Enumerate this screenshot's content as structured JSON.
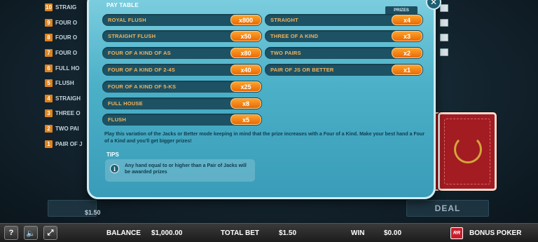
{
  "paytable": {
    "title": "PAY TABLE",
    "prizes_label": "PRIZES",
    "left_rows": [
      {
        "hand": "ROYAL FLUSH",
        "multiplier": "x800"
      },
      {
        "hand": "STRAIGHT FLUSH",
        "multiplier": "x50"
      },
      {
        "hand": "FOUR OF A KIND OF AS",
        "multiplier": "x80"
      },
      {
        "hand": "FOUR OF A KIND OF 2-4S",
        "multiplier": "x40"
      },
      {
        "hand": "FOUR OF A KIND OF 5-KS",
        "multiplier": "x25"
      },
      {
        "hand": "FULL HOUSE",
        "multiplier": "x8"
      },
      {
        "hand": "FLUSH",
        "multiplier": "x5"
      }
    ],
    "right_rows": [
      {
        "hand": "STRAIGHT",
        "multiplier": "x4"
      },
      {
        "hand": "THREE OF A KIND",
        "multiplier": "x3"
      },
      {
        "hand": "TWO PAIRS",
        "multiplier": "x2"
      },
      {
        "hand": "PAIR OF JS OR BETTER",
        "multiplier": "x1"
      }
    ],
    "description": "Play this variation of the Jacks or Better mode keeping in mind that the prize increases with a Four of a Kind. Make your best hand a Four of a Kind and you'll get bigger prizes!",
    "tips_title": "TIPS",
    "tips_text": "Any hand equal to or higher than a Pair of Jacks will be awarded prizes"
  },
  "background_ranks": [
    {
      "num": "10",
      "label": "STRAIG"
    },
    {
      "num": "9",
      "label": "FOUR O"
    },
    {
      "num": "8",
      "label": "FOUR O"
    },
    {
      "num": "7",
      "label": "FOUR O"
    },
    {
      "num": "6",
      "label": "FULL HO"
    },
    {
      "num": "5",
      "label": "FLUSH"
    },
    {
      "num": "4",
      "label": "STRAIGH"
    },
    {
      "num": "3",
      "label": "THREE O"
    },
    {
      "num": "2",
      "label": "TWO PAI"
    },
    {
      "num": "1",
      "label": "PAIR OF J"
    }
  ],
  "table": {
    "bet_value": "$1.50",
    "deal_label": "DEAL"
  },
  "bottom_bar": {
    "help_icon": "question-mark-icon",
    "help_glyph": "?",
    "sound_icon": "speaker-icon",
    "sound_glyph": "🔈",
    "fullscreen_icon": "expand-icon",
    "fullscreen_glyph": "⤢",
    "balance_label": "BALANCE",
    "balance_value": "$1,000.00",
    "total_bet_label": "TOTAL BET",
    "total_bet_value": "$1.50",
    "win_label": "WIN",
    "win_value": "$0.00",
    "brand_logo_text": "RR",
    "game_name": "BONUS POKER"
  },
  "colors": {
    "multiplier_orange": "#e86a08",
    "hand_text": "#f3b35b",
    "modal_teal": "#4bb0c8",
    "card_red": "#a21c22"
  }
}
